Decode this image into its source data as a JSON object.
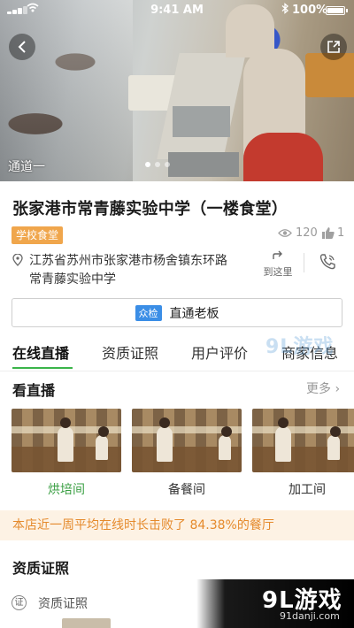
{
  "status_bar": {
    "time": "9:41 AM",
    "battery": "100%"
  },
  "hero": {
    "channel_label": "通道一",
    "page_count": 3,
    "active_page": 1
  },
  "store": {
    "name": "张家港市常青藤实验中学（一楼食堂）",
    "tag": "学校食堂",
    "views": "120",
    "likes": "1",
    "address_line1": "江苏省苏州市张家港市杨舍镇东环路",
    "address_line2": "常青藤实验中学",
    "goto_label": "到这里"
  },
  "boss_button": {
    "badge": "众检",
    "label": "直通老板"
  },
  "tabs": [
    {
      "label": "在线直播",
      "active": true
    },
    {
      "label": "资质证照",
      "active": false
    },
    {
      "label": "用户评价",
      "active": false
    },
    {
      "label": "商家信息",
      "active": false
    }
  ],
  "live": {
    "title": "看直播",
    "more_label": "更多",
    "cameras": [
      {
        "label": "烘培间",
        "active": true
      },
      {
        "label": "备餐间",
        "active": false
      },
      {
        "label": "加工间",
        "active": false
      }
    ]
  },
  "banner": {
    "text": "本店近一周平均在线时长击败了 84.38%的餐厅"
  },
  "certificates": {
    "title": "资质证照",
    "icon_char": "证",
    "row_label": "资质证照"
  },
  "watermark": {
    "logo": "9L游戏",
    "url": "91danji.com",
    "mid": "9L游戏"
  },
  "colors": {
    "accent_green": "#3bb44a",
    "tag_orange": "#f0a64c",
    "banner_text": "#e58a2c",
    "badge_blue": "#3b8ee6"
  }
}
